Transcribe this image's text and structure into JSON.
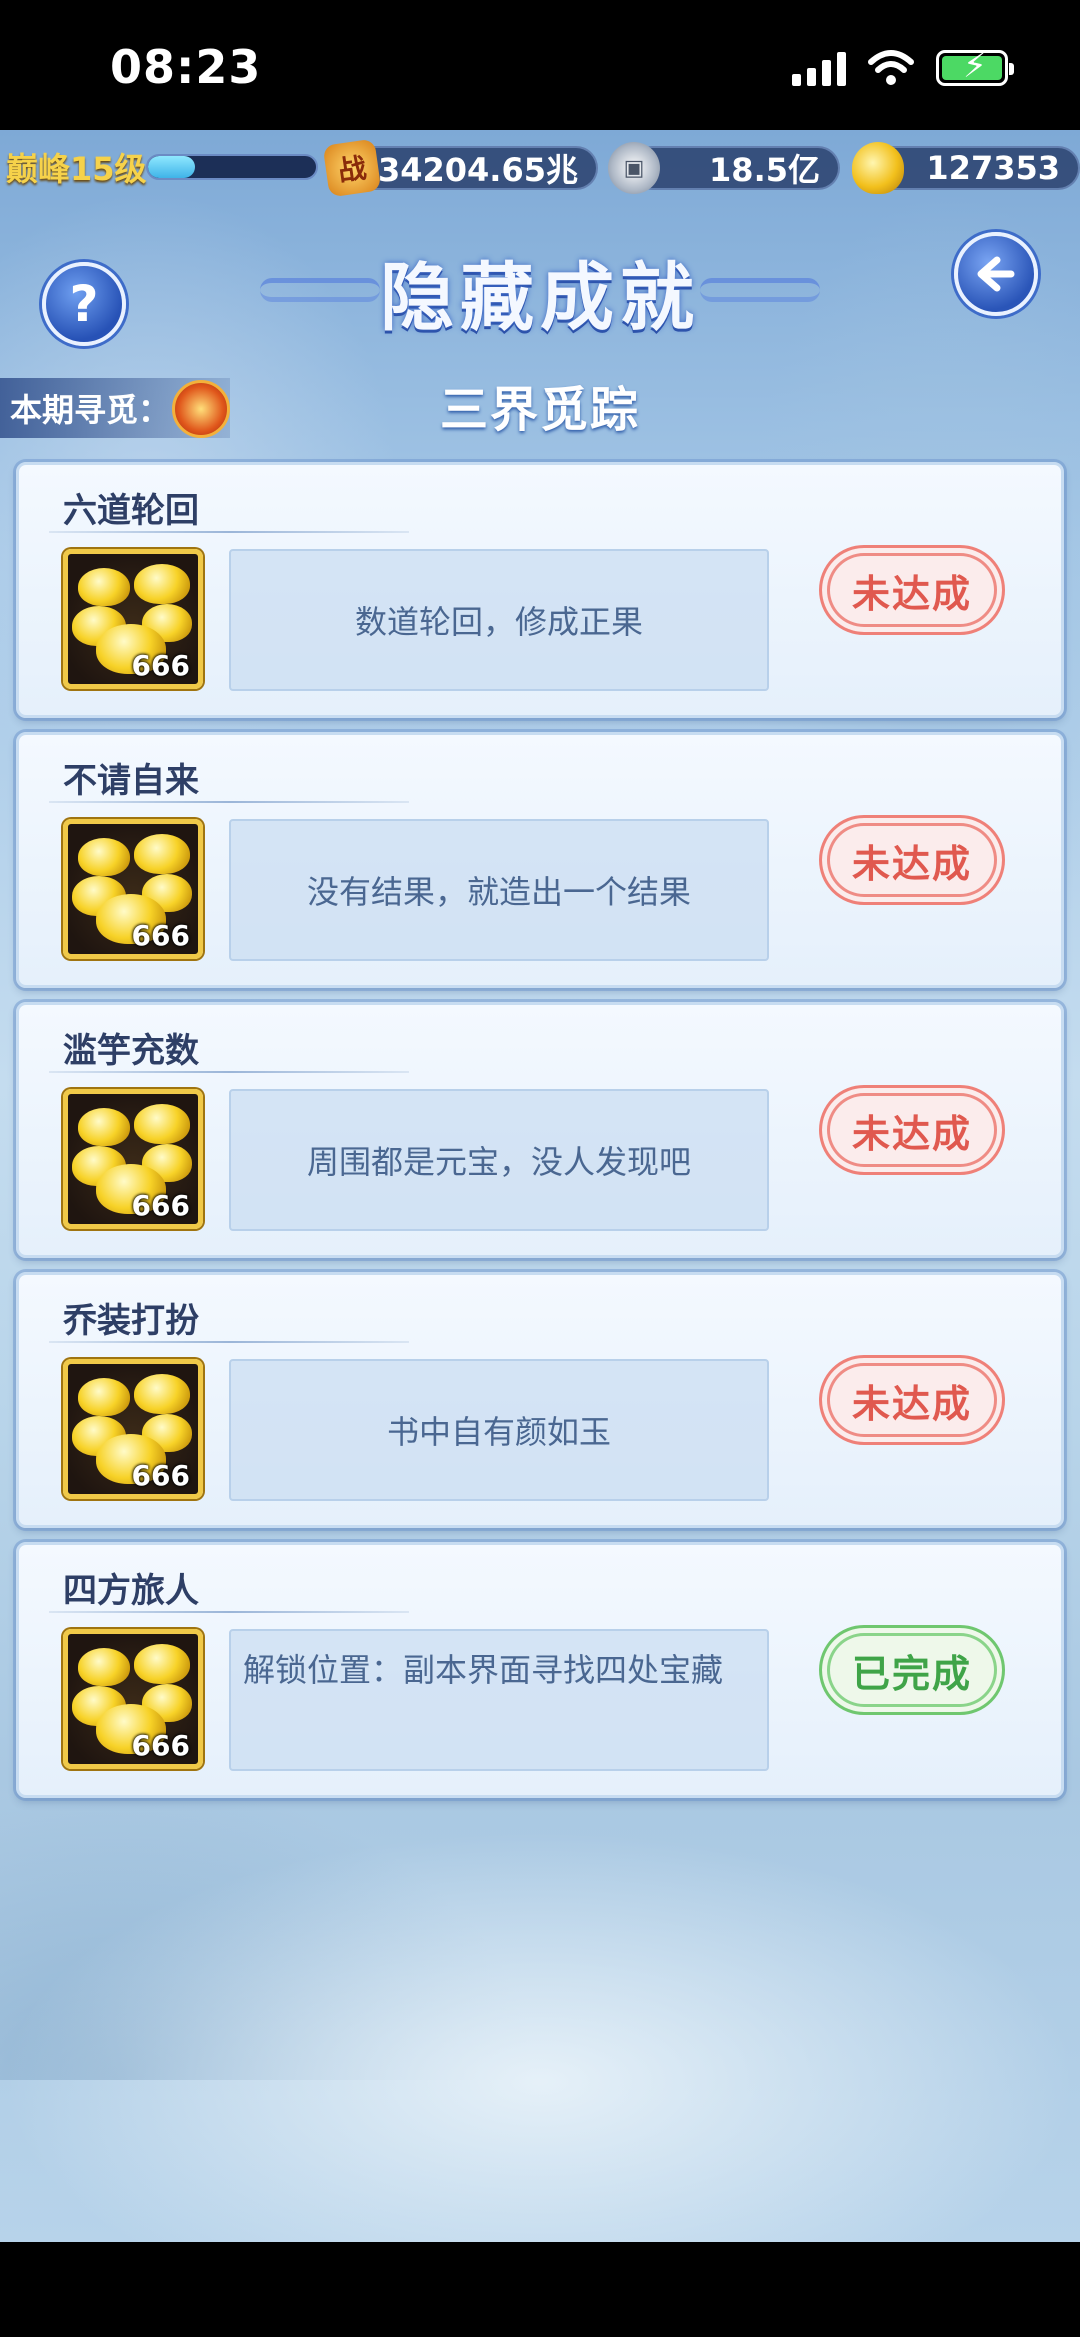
{
  "status_bar": {
    "time": "08:23"
  },
  "resources": {
    "level": "巅峰15级",
    "xp_progress": 0.28,
    "combat_power": "234204.65兆",
    "silver": "18.5亿",
    "gold": "127353",
    "power_icon_text": "战"
  },
  "header": {
    "title": "隐藏成就",
    "period_label": "本期寻觅：",
    "subtitle": "三界觅踪",
    "help_symbol": "?",
    "back_symbol": "<"
  },
  "achievements": [
    {
      "title": "六道轮回",
      "reward_count": "666",
      "description": "数道轮回，修成正果",
      "status": "未达成"
    },
    {
      "title": "不请自来",
      "reward_count": "666",
      "description": "没有结果，就造出一个结果",
      "status": "未达成"
    },
    {
      "title": "滥竽充数",
      "reward_count": "666",
      "description": "周围都是元宝，没人发现吧",
      "status": "未达成"
    },
    {
      "title": "乔装打扮",
      "reward_count": "666",
      "description": "书中自有颜如玉",
      "status": "未达成"
    },
    {
      "title": "四方旅人",
      "reward_count": "666",
      "description": "解锁位置：副本界面寻找四处宝藏",
      "status": "已完成"
    }
  ],
  "colors": {
    "pending": "#e0594f",
    "done": "#3fa448",
    "level_gold": "#f6d24a"
  }
}
